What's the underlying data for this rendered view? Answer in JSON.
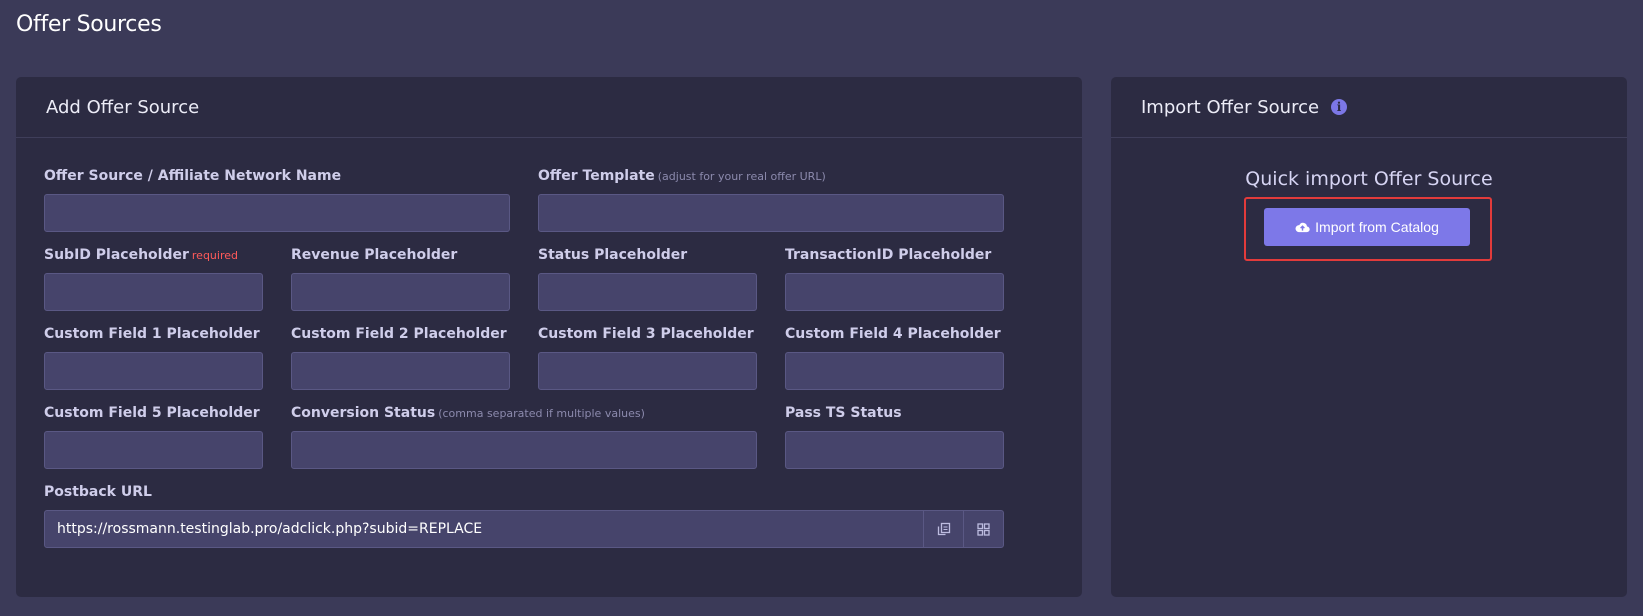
{
  "page_title": "Offer Sources",
  "add_card": {
    "title": "Add Offer Source",
    "fields": {
      "network_name": {
        "label": "Offer Source / Affiliate Network Name",
        "value": ""
      },
      "offer_template": {
        "label": "Offer Template",
        "hint": "(adjust for your real offer URL)",
        "value": ""
      },
      "subid": {
        "label": "SubID Placeholder",
        "required": "required",
        "value": ""
      },
      "revenue": {
        "label": "Revenue Placeholder",
        "value": ""
      },
      "status": {
        "label": "Status Placeholder",
        "value": ""
      },
      "transaction_id": {
        "label": "TransactionID Placeholder",
        "value": ""
      },
      "custom1": {
        "label": "Custom Field 1 Placeholder",
        "value": ""
      },
      "custom2": {
        "label": "Custom Field 2 Placeholder",
        "value": ""
      },
      "custom3": {
        "label": "Custom Field 3 Placeholder",
        "value": ""
      },
      "custom4": {
        "label": "Custom Field 4 Placeholder",
        "value": ""
      },
      "custom5": {
        "label": "Custom Field 5 Placeholder",
        "value": ""
      },
      "conversion_status": {
        "label": "Conversion Status",
        "hint": "(comma separated if multiple values)",
        "value": ""
      },
      "pass_ts_status": {
        "label": "Pass TS Status",
        "value": ""
      },
      "postback_url": {
        "label": "Postback URL",
        "value": "https://rossmann.testinglab.pro/adclick.php?subid=REPLACE"
      }
    },
    "postback_actions": {
      "copy_icon": "copy-icon",
      "qr_icon": "qr-code-icon"
    }
  },
  "import_card": {
    "title": "Import Offer Source",
    "info_icon": "i",
    "quick_title": "Quick import Offer Source",
    "import_button": "Import from Catalog",
    "import_icon": "cloud-upload-icon"
  },
  "colors": {
    "background": "#3b3a58",
    "card": "#2c2b42",
    "input": "#46446b",
    "accent": "#7d78e8",
    "required": "#ff5a5a",
    "highlight": "#e23b3b"
  }
}
